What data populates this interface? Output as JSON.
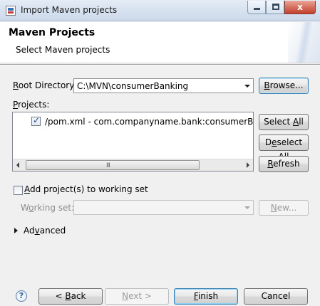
{
  "window": {
    "title": "Import Maven projects",
    "controls": {
      "minimize_icon": "minimize-icon",
      "maximize_icon": "maximize-icon",
      "close_icon": "close-icon",
      "close_glyph": "x"
    }
  },
  "header": {
    "title": "Maven Projects",
    "subtitle": "Select Maven projects"
  },
  "root_directory": {
    "label_accel": "R",
    "label_rest": "oot Directory:",
    "value": "C:\\MVN\\consumerBanking",
    "browse_accel": "B",
    "browse_rest": "rowse..."
  },
  "projects": {
    "label_accel": "P",
    "label_rest": "rojects:",
    "items": [
      {
        "checked": true,
        "label": "/pom.xml - com.companyname.bank:consumerBankin"
      }
    ],
    "scroll_grip": "III"
  },
  "side_buttons": {
    "select_all_pre": "Select ",
    "select_all_accel": "A",
    "select_all_post": "ll",
    "deselect_all_pre": "D",
    "deselect_all_accel": "e",
    "deselect_all_post": "select All",
    "refresh_accel": "R",
    "refresh_rest": "efresh"
  },
  "working_set": {
    "add_checked": false,
    "add_accel": "A",
    "add_rest": "dd project(s) to working set",
    "label_pre": "W",
    "label_accel": "o",
    "label_post": "rking set:",
    "value": "",
    "new_accel": "N",
    "new_rest": "ew..."
  },
  "advanced": {
    "label_accel": "v",
    "label_pre": "Ad",
    "label_post": "anced",
    "expanded": false
  },
  "footer": {
    "help_glyph": "?",
    "back_pre": "< ",
    "back_accel": "B",
    "back_post": "ack",
    "next_pre": "",
    "next_accel": "N",
    "next_post": "ext >",
    "finish_accel": "F",
    "finish_rest": "inish",
    "cancel": "Cancel"
  }
}
